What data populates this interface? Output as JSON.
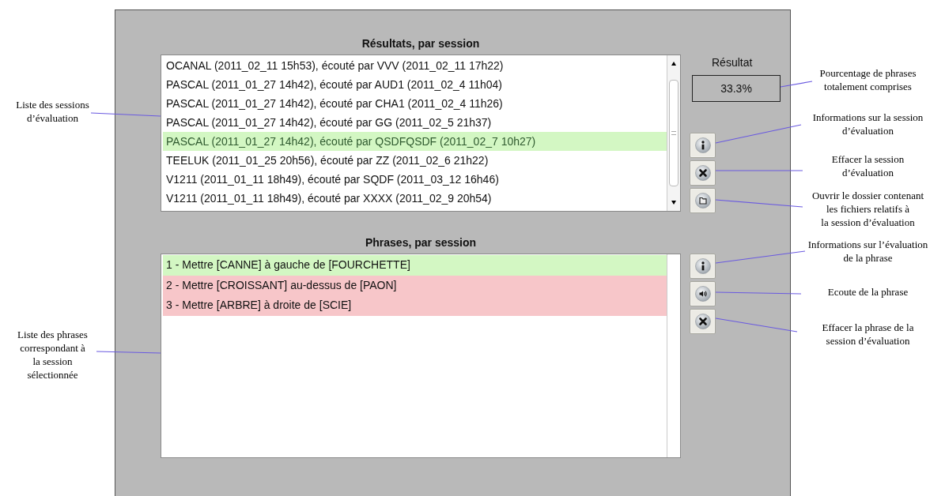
{
  "left_notes": [
    {
      "text": "Liste des sessions\nd’évaluation"
    },
    {
      "text": "Liste des phrases\ncorrespondant à\nla session\nsélectionnée"
    }
  ],
  "sessions": {
    "title": "Résultats, par session",
    "rows": [
      {
        "text": "OCANAL (2011_02_11 15h53), écouté par VVV (2011_02_11 17h22)",
        "selected": false
      },
      {
        "text": "PASCAL (2011_01_27 14h42), écouté par AUD1 (2011_02_4 11h04)",
        "selected": false
      },
      {
        "text": "PASCAL (2011_01_27 14h42), écouté par CHA1 (2011_02_4 11h26)",
        "selected": false
      },
      {
        "text": "PASCAL (2011_01_27 14h42), écouté par GG (2011_02_5 21h37)",
        "selected": false
      },
      {
        "text": "PASCAL (2011_01_27 14h42), écouté par QSDFQSDF (2011_02_7 10h27)",
        "selected": true
      },
      {
        "text": "TEELUK (2011_01_25 20h56), écouté par ZZ (2011_02_6 21h22)",
        "selected": false
      },
      {
        "text": "V1211 (2011_01_11 18h49), écouté par SQDF (2011_03_12 16h46)",
        "selected": false
      },
      {
        "text": "V1211 (2011_01_11 18h49), écouté par XXXX (2011_02_9 20h54)",
        "selected": false
      }
    ],
    "result_label": "Résultat",
    "result_value": "33.3%",
    "buttons": [
      {
        "kind": "info"
      },
      {
        "kind": "delete"
      },
      {
        "kind": "folder"
      }
    ]
  },
  "phrases": {
    "title": "Phrases, par session",
    "rows": [
      {
        "text": "1 - Mettre [CANNE] à gauche de [FOURCHETTE]",
        "color": "#d3f7c3"
      },
      {
        "text": "2 - Mettre [CROISSANT] au-dessus de [PAON]",
        "color": "#f7c6c9"
      },
      {
        "text": "3 - Mettre [ARBRE] à droite de [SCIE]",
        "color": "#f7c6c9"
      }
    ],
    "buttons": [
      {
        "kind": "info"
      },
      {
        "kind": "sound"
      },
      {
        "kind": "delete"
      }
    ]
  },
  "right_notes": [
    {
      "text": "Pourcentage de phrases\ntotalement comprises"
    },
    {
      "text": "Informations sur la session\nd’évaluation"
    },
    {
      "text": "Effacer la session\nd’évaluation"
    },
    {
      "text": "Ouvrir le dossier contenant\nles fichiers relatifs à\nla session d’évaluation"
    },
    {
      "text": "Informations sur l’évaluation\nde la phrase"
    },
    {
      "text": "Ecoute de la phrase"
    },
    {
      "text": "Effacer la phrase de la\nsession d’évaluation"
    }
  ]
}
